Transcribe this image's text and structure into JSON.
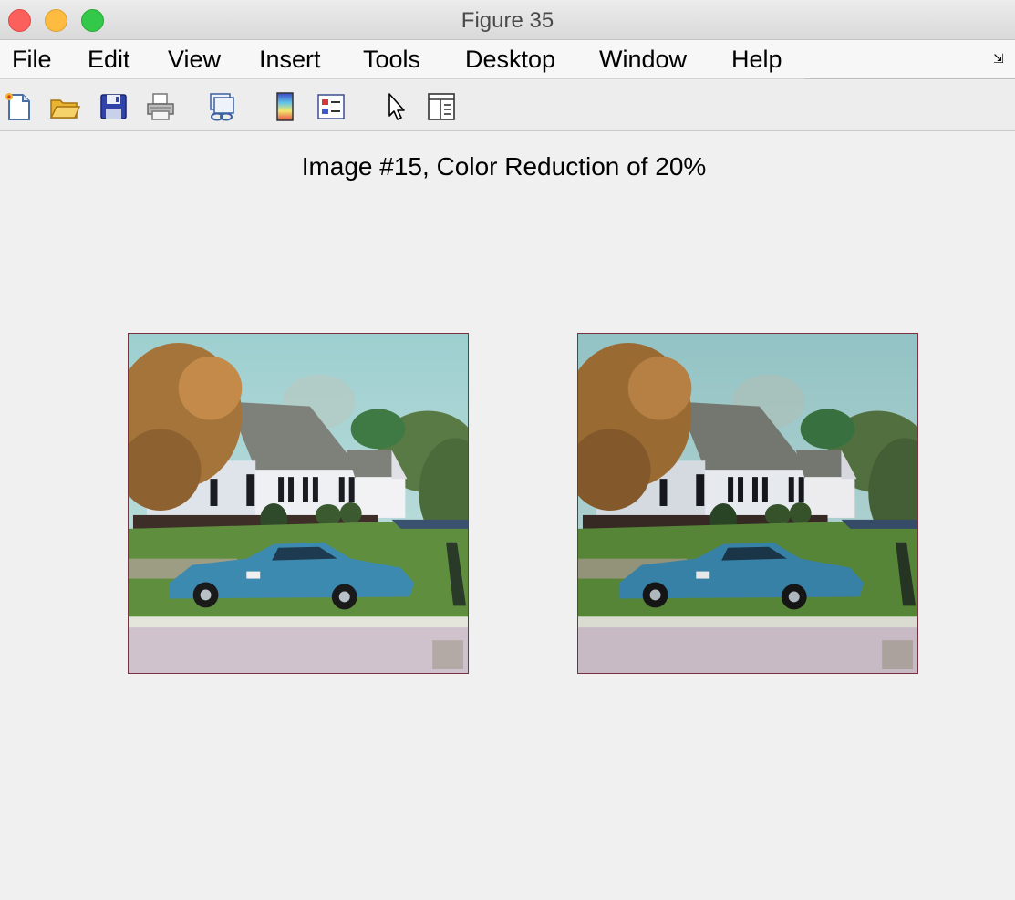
{
  "window": {
    "title": "Figure 35"
  },
  "menu": [
    "File",
    "Edit",
    "View",
    "Insert",
    "Tools",
    "Desktop",
    "Window",
    "Help"
  ],
  "toolbar": [
    "new-figure-icon",
    "open-file-icon",
    "save-icon",
    "print-icon",
    "link-plot-icon",
    "colorbar-icon",
    "legend-icon",
    "select-pointer-icon",
    "property-editor-icon"
  ],
  "figure": {
    "title": "Image #15, Color Reduction of 20%",
    "images": [
      {
        "name": "original-image",
        "palette": "original"
      },
      {
        "name": "color-reduced-image",
        "palette": "reduced"
      }
    ]
  },
  "colors": {
    "sky": "#a9d3d3",
    "grass": "#5f8f3e",
    "car": "#3d8ab0",
    "house": "#eef0f4",
    "roof": "#7d8179",
    "tree": "#a5743a",
    "pavement": "#cfc2cc"
  }
}
